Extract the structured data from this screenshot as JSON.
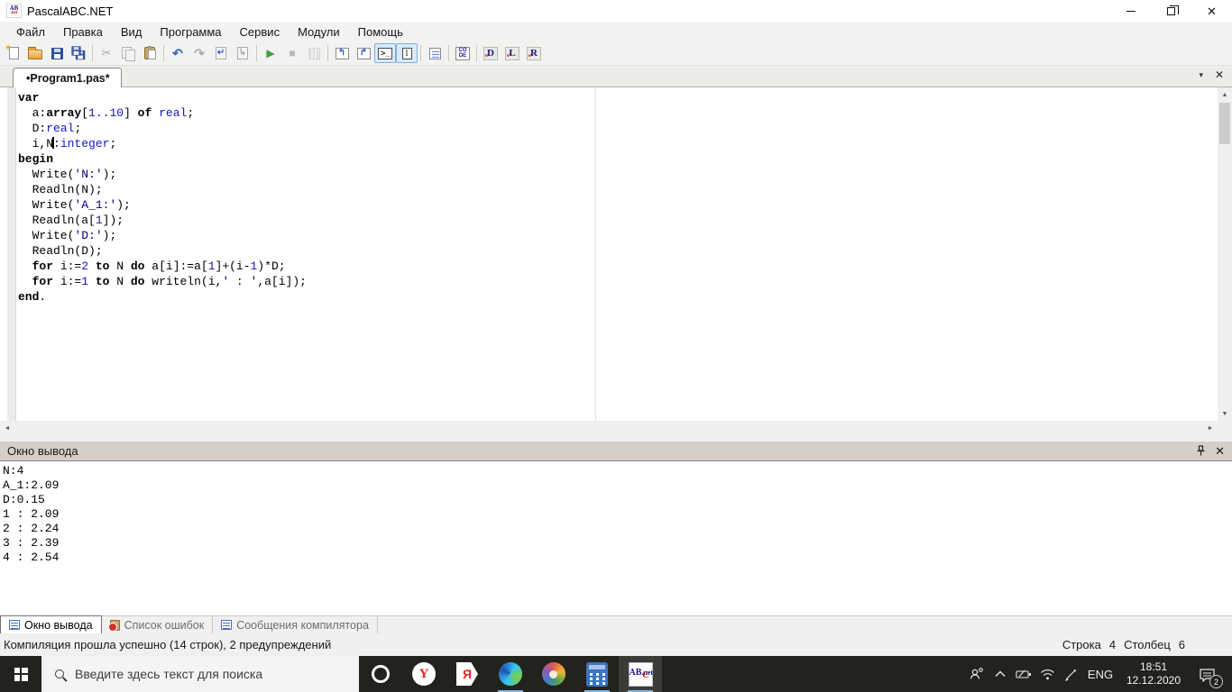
{
  "window": {
    "title": "PascalABC.NET"
  },
  "menu": {
    "items": [
      "Файл",
      "Правка",
      "Вид",
      "Программа",
      "Сервис",
      "Модули",
      "Помощь"
    ]
  },
  "toolbar": {
    "buttons": [
      "new-file",
      "open-file",
      "save",
      "save-all",
      "cut",
      "copy",
      "paste",
      "undo",
      "redo",
      "goto-prev",
      "goto-next",
      "run",
      "stop",
      "step-grid",
      "run-in-console",
      "run-to-cursor",
      "console-panel-toggle",
      "text-cursor-toggle",
      "format-code",
      "code-templates",
      "watch-d",
      "watch-l",
      "watch-r"
    ]
  },
  "icons": {
    "star": "★",
    "cut": "✂",
    "undo": "↶",
    "redo": "↷",
    "page_arrow_left": "↵",
    "page_arrow_right": "↳",
    "run": "▶",
    "stop": "■",
    "win_arrow_1": "↰",
    "win_arrow_2": "↱",
    "console_glyph": ">_",
    "caret_glyph": "I",
    "code_top": "CO",
    "code_bottom": "DE",
    "watch_arrow": "↙",
    "watch_d": "D",
    "watch_l": "L",
    "watch_r": "R",
    "tab_menu": "▾",
    "close": "✕",
    "arrow_up": "▲",
    "arrow_down": "▼",
    "arrow_left": "◄",
    "arrow_right": "►",
    "app_icon_ab": "AB",
    "app_icon_net": ".net",
    "yandex_browser_letter": "Y",
    "yandex_letter": "Я",
    "pabc_l1": "AB",
    "pabc_c": "C",
    "pabc_l2": ".net"
  },
  "colors": {
    "keyword": "#000000",
    "type": "#1414c8",
    "number": "#1414c8",
    "string": "#000080",
    "run_green": "#3f9e3f",
    "toggle_border": "#7ab0e0",
    "taskbar_accent": "#76b9ed"
  },
  "tab_strip": {
    "active_tab": "•Program1.pas*"
  },
  "editor": {
    "lines": [
      [
        [
          "kw",
          "var"
        ]
      ],
      [
        [
          "pl",
          "  a:"
        ],
        [
          "kw",
          "array"
        ],
        [
          "pl",
          "["
        ],
        [
          "num",
          "1..10"
        ],
        [
          "pl",
          "] "
        ],
        [
          "kw",
          "of"
        ],
        [
          "pl",
          " "
        ],
        [
          "typ",
          "real"
        ],
        [
          "pl",
          ";"
        ]
      ],
      [
        [
          "pl",
          "  D:"
        ],
        [
          "typ",
          "real"
        ],
        [
          "pl",
          ";"
        ]
      ],
      [
        [
          "pl",
          "  i,N"
        ],
        [
          "caret",
          ""
        ],
        [
          "pl",
          ":"
        ],
        [
          "typ",
          "integer"
        ],
        [
          "pl",
          ";"
        ]
      ],
      [
        [
          "kw",
          "begin"
        ]
      ],
      [
        [
          "pl",
          "  Write("
        ],
        [
          "str",
          "'N:'"
        ],
        [
          "pl",
          ");"
        ]
      ],
      [
        [
          "pl",
          "  Readln(N);"
        ]
      ],
      [
        [
          "pl",
          "  Write("
        ],
        [
          "str",
          "'A_1:'"
        ],
        [
          "pl",
          ");"
        ]
      ],
      [
        [
          "pl",
          "  Readln(a["
        ],
        [
          "num",
          "1"
        ],
        [
          "pl",
          "]);"
        ]
      ],
      [
        [
          "pl",
          "  Write("
        ],
        [
          "str",
          "'D:'"
        ],
        [
          "pl",
          ");"
        ]
      ],
      [
        [
          "pl",
          "  Readln(D);"
        ]
      ],
      [
        [
          "pl",
          "  "
        ],
        [
          "kw",
          "for"
        ],
        [
          "pl",
          " i:="
        ],
        [
          "num",
          "2"
        ],
        [
          "pl",
          " "
        ],
        [
          "kw",
          "to"
        ],
        [
          "pl",
          " N "
        ],
        [
          "kw",
          "do"
        ],
        [
          "pl",
          " a[i]:=a["
        ],
        [
          "num",
          "1"
        ],
        [
          "pl",
          "]+(i-"
        ],
        [
          "num",
          "1"
        ],
        [
          "pl",
          ")*D;"
        ]
      ],
      [
        [
          "pl",
          "  "
        ],
        [
          "kw",
          "for"
        ],
        [
          "pl",
          " i:="
        ],
        [
          "num",
          "1"
        ],
        [
          "pl",
          " "
        ],
        [
          "kw",
          "to"
        ],
        [
          "pl",
          " N "
        ],
        [
          "kw",
          "do"
        ],
        [
          "pl",
          " writeln(i,"
        ],
        [
          "str",
          "' : '"
        ],
        [
          "pl",
          ",a[i]);"
        ]
      ],
      [
        [
          "kw",
          "end"
        ],
        [
          "pl",
          "."
        ]
      ]
    ]
  },
  "output_panel": {
    "title": "Окно вывода",
    "lines": [
      "N:4",
      "A_1:2.09",
      "D:0.15",
      "1 : 2.09",
      "2 : 2.24",
      "3 : 2.39",
      "4 : 2.54"
    ]
  },
  "bottom_tabs": {
    "tabs": [
      {
        "label": "Окно вывода",
        "active": true
      },
      {
        "label": "Список ошибок",
        "active": false
      },
      {
        "label": "Сообщения компилятора",
        "active": false
      }
    ]
  },
  "status_bar": {
    "message": "Компиляция прошла успешно (14 строк), 2 предупреждений",
    "line_label": "Строка",
    "line_value": "4",
    "column_label": "Столбец",
    "column_value": "6"
  },
  "taskbar": {
    "search_placeholder": "Введите здесь текст для поиска",
    "apps": [
      "opera",
      "yandex-browser",
      "yandex",
      "edge",
      "paint",
      "calculator",
      "pascalabc"
    ],
    "tray": {
      "language": "ENG",
      "time": "18:51",
      "date": "12.12.2020",
      "notification_count": "2"
    }
  }
}
